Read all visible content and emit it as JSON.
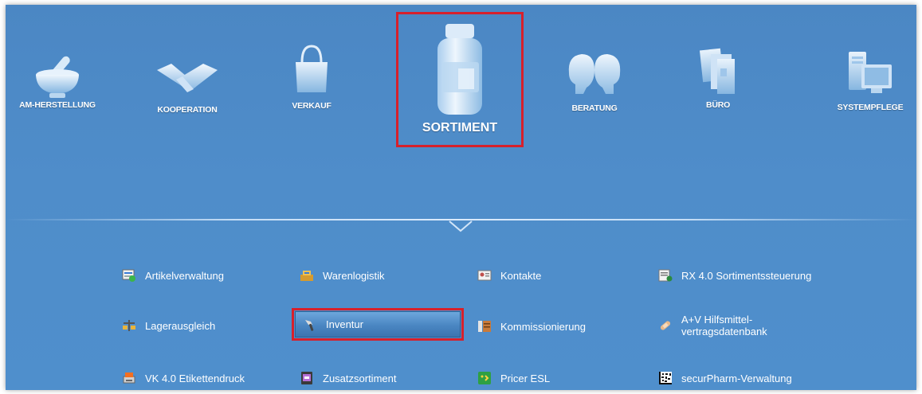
{
  "categories": [
    {
      "label": "AM-HERSTELLUNG",
      "icon": "mortar-pestle-icon"
    },
    {
      "label": "KOOPERATION",
      "icon": "handshake-icon"
    },
    {
      "label": "VERKAUF",
      "icon": "shopping-bag-icon"
    },
    {
      "label": "SORTIMENT",
      "icon": "medicine-bottle-icon",
      "selected": true
    },
    {
      "label": "BERATUNG",
      "icon": "consultation-heads-icon"
    },
    {
      "label": "BÜRO",
      "icon": "office-documents-icon"
    },
    {
      "label": "SYSTEMPFLEGE",
      "icon": "computer-system-icon"
    }
  ],
  "menu": {
    "artikelverwaltung": "Artikelverwaltung",
    "warenlogistik": "Warenlogistik",
    "kontakte": "Kontakte",
    "rx_sortimentssteuerung": "RX 4.0 Sortimentssteuerung",
    "lagerausgleich": "Lagerausgleich",
    "inventur": "Inventur",
    "kommissionierung": "Kommissionierung",
    "hilfsmittel_line1": "A+V Hilfsmittel-",
    "hilfsmittel_line2": "vertragsdatenbank",
    "etikettendruck": "VK 4.0 Etikettendruck",
    "zusatzsortiment": "Zusatzsortiment",
    "pricer_esl": "Pricer ESL",
    "securpharm": "securPharm-Verwaltung"
  },
  "colors": {
    "background": "#4f8dca",
    "highlight": "#d7202b",
    "text": "#ffffff"
  }
}
